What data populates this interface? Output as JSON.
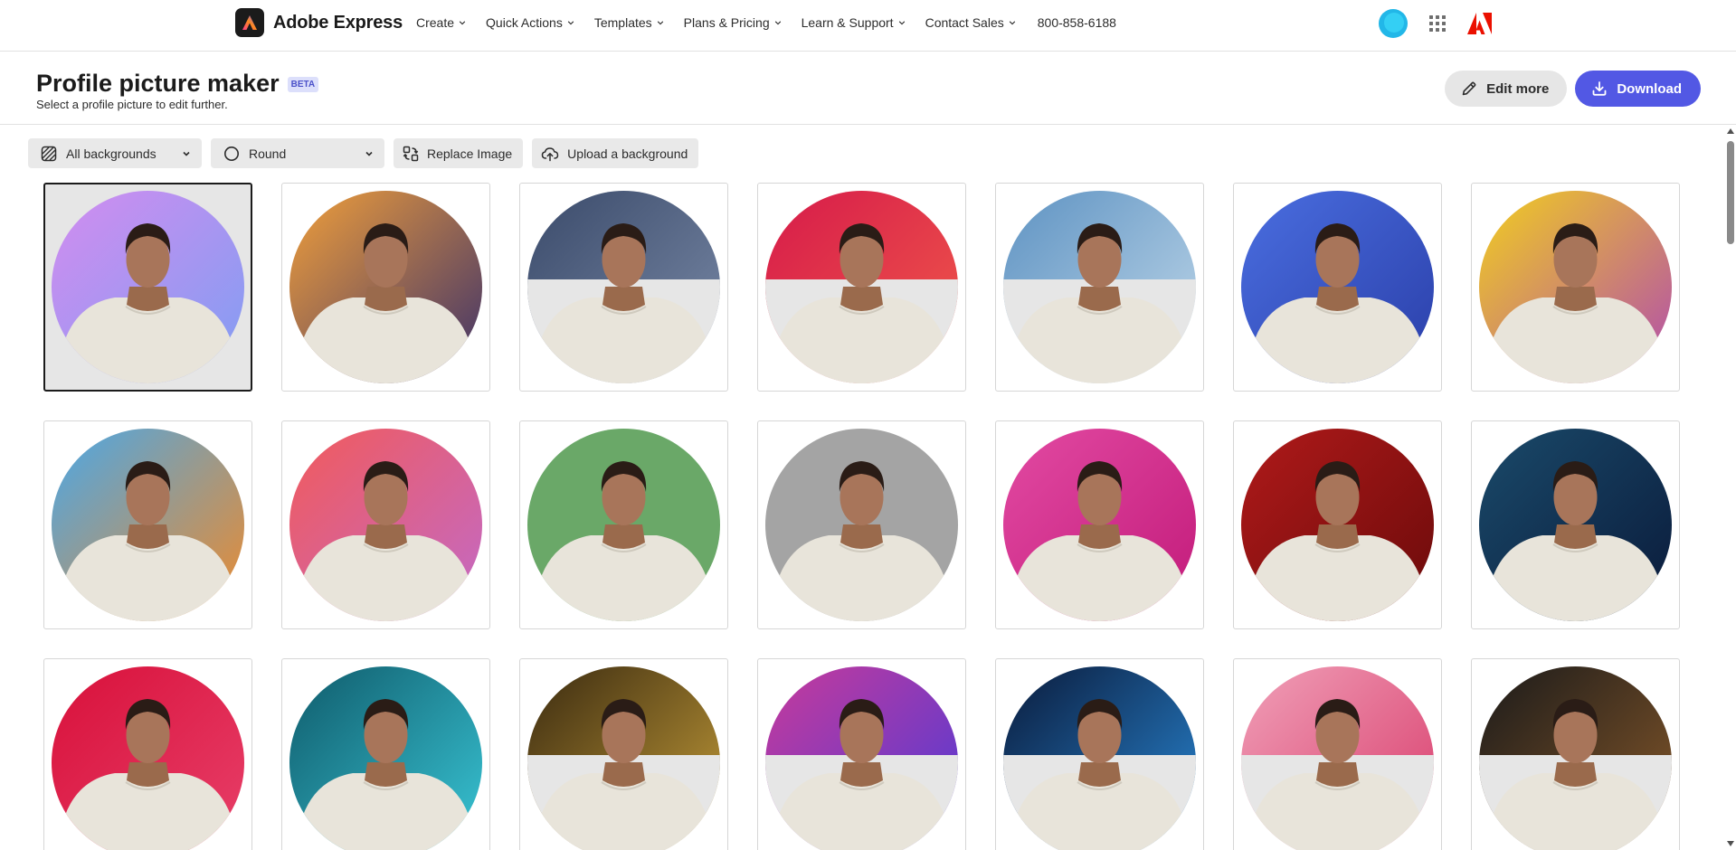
{
  "brand": {
    "name": "Adobe Express"
  },
  "nav": {
    "items": [
      {
        "label": "Create"
      },
      {
        "label": "Quick Actions"
      },
      {
        "label": "Templates"
      },
      {
        "label": "Plans & Pricing"
      },
      {
        "label": "Learn & Support"
      },
      {
        "label": "Contact Sales"
      }
    ],
    "phone": "800-858-6188"
  },
  "header": {
    "title": "Profile picture maker",
    "badge": "BETA",
    "subtitle": "Select a profile picture to edit further.",
    "edit_label": "Edit more",
    "download_label": "Download"
  },
  "toolbar": {
    "background_filter": "All backgrounds",
    "shape": "Round",
    "replace_label": "Replace Image",
    "upload_label": "Upload a background"
  },
  "colors": {
    "accent": "#5258e4",
    "beta_bg": "#dcdffb",
    "beta_text": "#4b51c9",
    "adobe_red": "#eb1000"
  },
  "backgrounds": [
    {
      "name": "holographic-purple",
      "top": "#d38cf0",
      "bottom": "#7f9ef2",
      "split": false
    },
    {
      "name": "orange-purple-gradient",
      "top": "#f2a03a",
      "bottom": "#3a2f6a",
      "split": false
    },
    {
      "name": "navy-texture",
      "top": "#3a4a6a",
      "bottom": "#7b8ba8",
      "split": true
    },
    {
      "name": "red-paint",
      "top": "#d61a4a",
      "bottom": "#f05a4a",
      "split": true
    },
    {
      "name": "sky-blue",
      "top": "#5d92c2",
      "bottom": "#c2d9ea",
      "split": true
    },
    {
      "name": "blue-knit",
      "top": "#4a6ee0",
      "bottom": "#2a3ea8",
      "split": false
    },
    {
      "name": "yellow-iridescent",
      "top": "#f2cf1e",
      "bottom": "#b04ab0",
      "split": false
    },
    {
      "name": "rainbow",
      "top": "#4aa8e8",
      "bottom": "#f08a2a",
      "split": false
    },
    {
      "name": "coral-gradient",
      "top": "#f25a5a",
      "bottom": "#c26ac8",
      "split": false
    },
    {
      "name": "green",
      "top": "#6aa868",
      "bottom": "#6aa868",
      "split": false
    },
    {
      "name": "gray",
      "top": "#a4a4a4",
      "bottom": "#a4a4a4",
      "split": false
    },
    {
      "name": "pink-knit",
      "top": "#e24aa2",
      "bottom": "#c21a7a",
      "split": false
    },
    {
      "name": "red-glitter",
      "top": "#b01a1a",
      "bottom": "#6a0a0a",
      "split": false
    },
    {
      "name": "teal-silk",
      "top": "#1a4a6a",
      "bottom": "#0a1a3a",
      "split": false
    },
    {
      "name": "red-hearts",
      "top": "#d8103a",
      "bottom": "#e8406a",
      "split": false
    },
    {
      "name": "teal-forest",
      "top": "#0f5a6a",
      "bottom": "#3ac8d8",
      "split": false
    },
    {
      "name": "gold-sequins",
      "top": "#3a2a10",
      "bottom": "#c8a03a",
      "split": true
    },
    {
      "name": "prism-bokeh",
      "top": "#c83a9a",
      "bottom": "#4a3ad8",
      "split": true
    },
    {
      "name": "blue-particles",
      "top": "#0a1a3a",
      "bottom": "#2a8ad8",
      "split": true
    },
    {
      "name": "pink-heart-bokeh",
      "top": "#f0a0b8",
      "bottom": "#d83a6a",
      "split": true
    },
    {
      "name": "stage-bokeh-microphone",
      "top": "#1a1a1a",
      "bottom": "#8a5a2a",
      "split": true
    }
  ]
}
